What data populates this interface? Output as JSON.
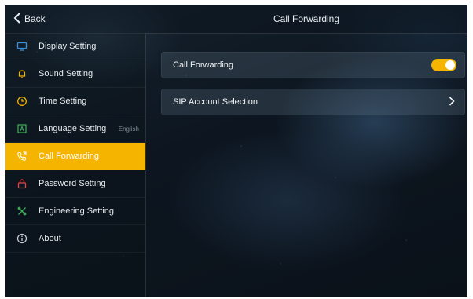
{
  "header": {
    "back_label": "Back",
    "title": "Call Forwarding"
  },
  "sidebar": {
    "items": [
      {
        "label": "Display Setting",
        "icon": "monitor-icon",
        "value": ""
      },
      {
        "label": "Sound Setting",
        "icon": "bell-icon",
        "value": ""
      },
      {
        "label": "Time Setting",
        "icon": "clock-icon",
        "value": ""
      },
      {
        "label": "Language Setting",
        "icon": "language-icon",
        "value": "English"
      },
      {
        "label": "Call Forwarding",
        "icon": "phone-forward-icon",
        "value": "",
        "active": true
      },
      {
        "label": "Password Setting",
        "icon": "lock-icon",
        "value": ""
      },
      {
        "label": "Engineering Setting",
        "icon": "tools-icon",
        "value": ""
      },
      {
        "label": "About",
        "icon": "info-icon",
        "value": ""
      }
    ]
  },
  "main": {
    "call_forwarding_label": "Call Forwarding",
    "call_forwarding_enabled": true,
    "sip_account_label": "SIP Account Selection"
  },
  "colors": {
    "accent": "#f5b400",
    "icon_blue": "#3a8fd8",
    "icon_yellow": "#f5b400",
    "icon_green": "#3fae5a",
    "icon_red": "#e04848",
    "icon_grey": "#c9d1d6"
  }
}
